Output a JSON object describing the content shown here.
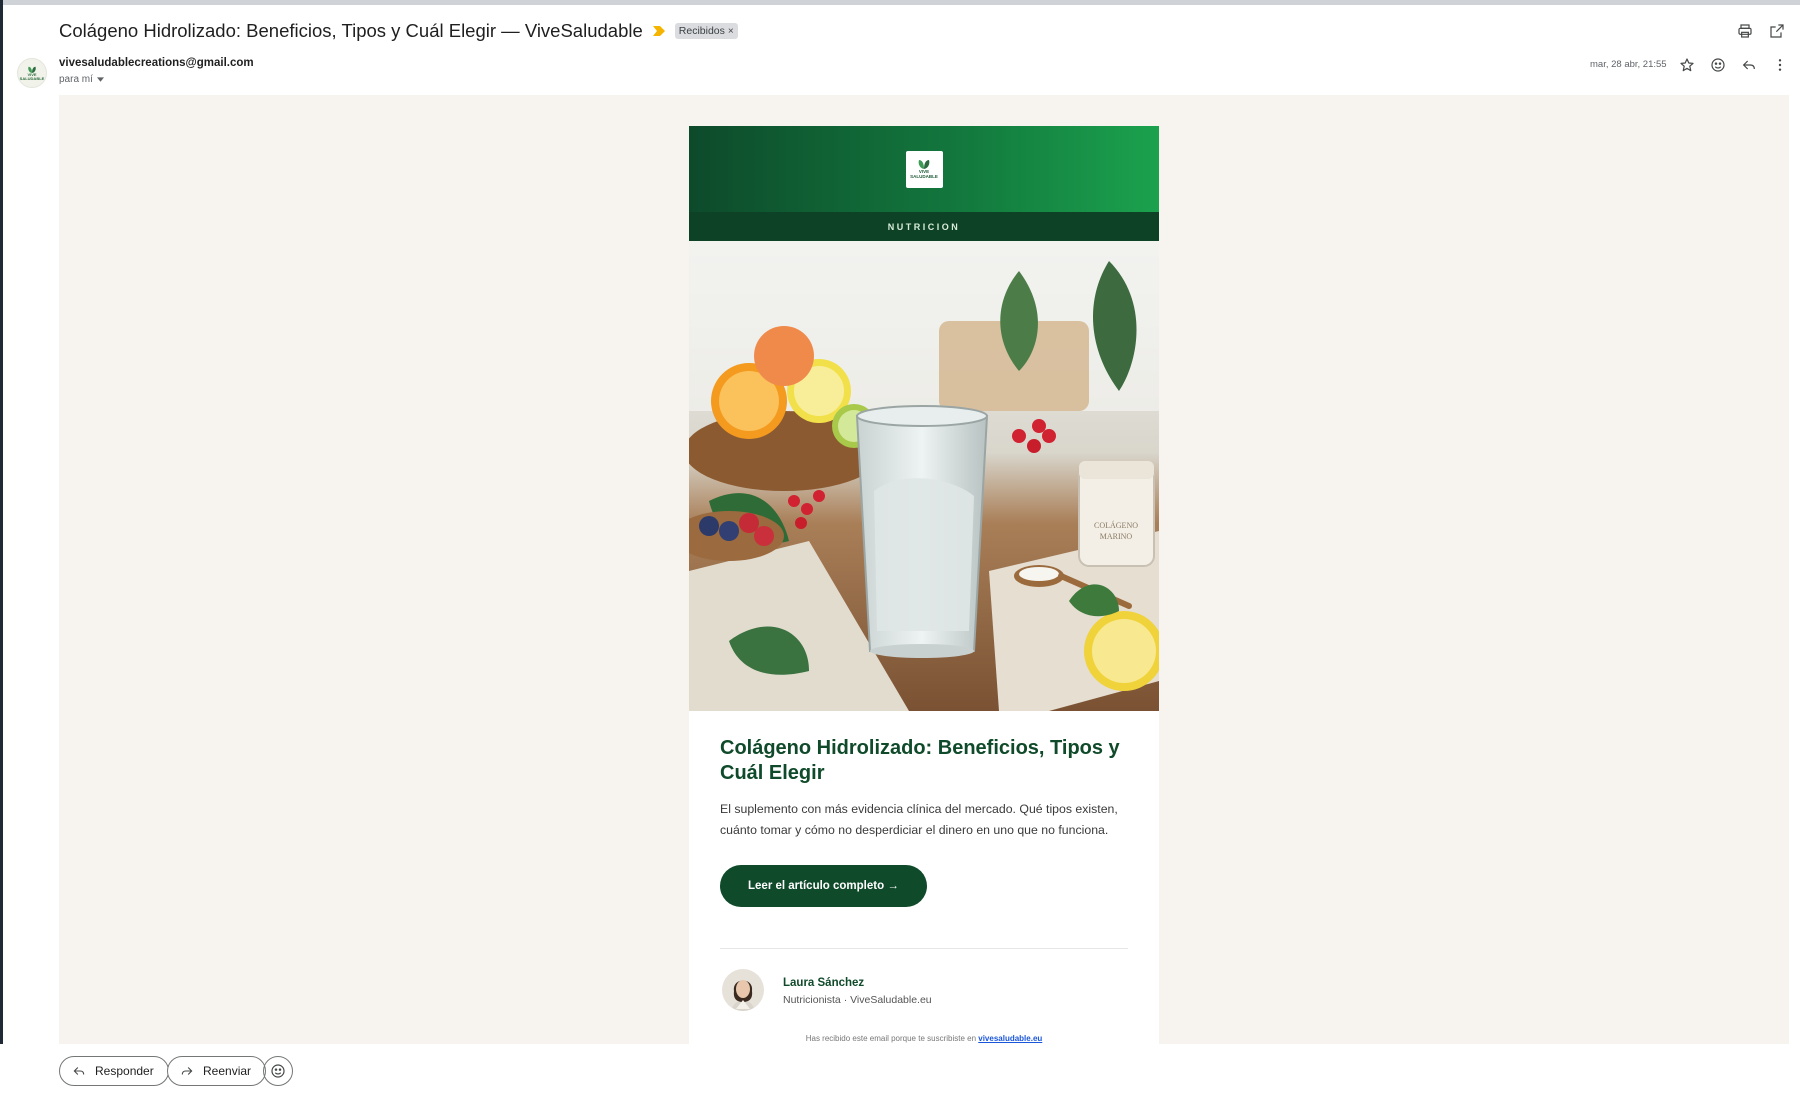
{
  "email": {
    "subject": "Colágeno Hidrolizado: Beneficios, Tipos y Cuál Elegir — ViveSaludable",
    "label": "Recibidos",
    "label_close": "×",
    "sender_email": "vivesaludablecreations@gmail.com",
    "recipient": "para mí",
    "date": "mar, 28 abr, 21:55"
  },
  "avatar": {
    "text_line1": "VIVE",
    "text_line2": "SALUDABLE"
  },
  "newsletter": {
    "logo_line1": "VIVE",
    "logo_line2": "SALUDABLE",
    "category": "NUTRICION",
    "jar_label_line1": "COLÁGENO",
    "jar_label_line2": "MARINO",
    "headline": "Colágeno Hidrolizado: Beneficios, Tipos y Cuál Elegir",
    "lead": "El suplemento con más evidencia clínica del mercado. Qué tipos existen, cuánto tomar y cómo no desperdiciar el dinero en uno que no funciona.",
    "cta_label": "Leer el artículo completo →",
    "author_name": "Laura Sánchez",
    "author_role": "Nutricionista · ViveSaludable.eu",
    "footer_text": "Has recibido este email porque te suscribiste en ",
    "footer_link": "vivesaludable.eu"
  },
  "actions": {
    "reply_label": "Responder",
    "forward_label": "Reenviar"
  },
  "colors": {
    "brand_dark_green": "#0f4a2a",
    "brand_green": "#1ba24e",
    "message_background": "#f7f4ef",
    "importance_marker": "#f4b400"
  },
  "icons": {
    "top": [
      "print-icon",
      "open-in-new-window-icon"
    ],
    "header_actions": [
      "star-icon",
      "emoji-reaction-icon",
      "reply-icon",
      "more-options-icon"
    ],
    "bottom": [
      "reply-icon",
      "forward-icon",
      "emoji-icon"
    ]
  }
}
